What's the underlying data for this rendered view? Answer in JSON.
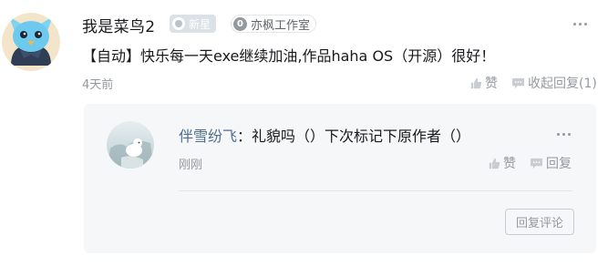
{
  "comment": {
    "username": "我是菜鸟2",
    "badge_new": "新星",
    "badge_studio_num": "0",
    "badge_studio_name": "亦枫工作室",
    "text": "【自动】快乐每一天exe继续加油,作品haha OS（开源）很好！",
    "time": "4天前",
    "like_label": "赞",
    "fold_reply_label": "收起回复(1)"
  },
  "reply": {
    "name": "伴雪纷飞",
    "separator": "：",
    "text": "礼貌吗（）下次标记下原作者（）",
    "time": "刚刚",
    "like_label": "赞",
    "reply_label": "回复"
  },
  "reply_comment_button": "回复评论",
  "icons": {
    "more": "more-dots-icon",
    "like": "thumbs-up-icon",
    "comment": "speech-bubble-icon"
  },
  "colors": {
    "name_link": "#4e6e8e",
    "muted": "#9499a0",
    "reply_bg": "#f6f7f8"
  }
}
